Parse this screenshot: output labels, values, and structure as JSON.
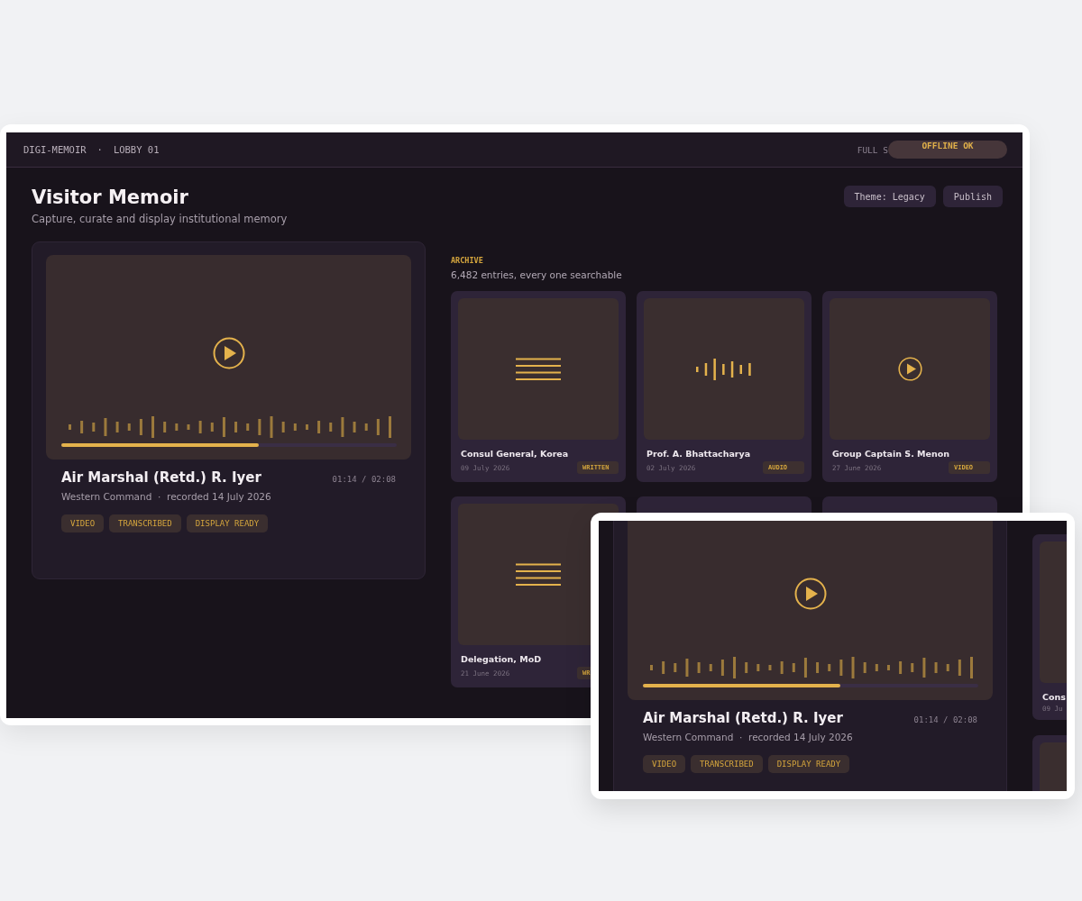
{
  "top_bar": {
    "brand": "DIGI-MEMOIR",
    "separator": "·",
    "location": "LOBBY 01",
    "mode": "FULL S",
    "status": "OFFLINE OK"
  },
  "header": {
    "title": "Visitor Memoir",
    "subtitle": "Capture, curate and display institutional memory",
    "buttons": [
      "Theme: Legacy",
      "Publish"
    ]
  },
  "featured": {
    "name": "Air Marshal (Retd.) R. Iyer",
    "time": "01:14 / 02:08",
    "subtitle": "Western Command  ·  recorded 14 July 2026",
    "level": 0.59,
    "tags": [
      "VIDEO",
      "TRANSCRIBED",
      "DISPLAY READY"
    ]
  },
  "archive": {
    "label": "ARCHIVE",
    "count": "6,482 entries, every one searchable",
    "cards": [
      {
        "kind": "written",
        "name": "Consul General, Korea",
        "date": "09 July 2026",
        "badge": "WRITTEN"
      },
      {
        "kind": "audio",
        "name": "Prof. A. Bhattacharya",
        "date": "02 July 2026",
        "badge": "AUDIO"
      },
      {
        "kind": "video",
        "name": "Group Captain S. Menon",
        "date": "27 June 2026",
        "badge": "VIDEO"
      },
      {
        "kind": "written",
        "name": "Delegation, MoD",
        "date": "21 June 2026",
        "badge": "WR"
      },
      {
        "kind": "covered"
      },
      {
        "kind": "covered"
      }
    ]
  },
  "zoom_inset": {
    "featured": {
      "name": "Air Marshal (Retd.) R. Iyer",
      "time": "01:14 / 02:08",
      "subtitle": "Western Command  ·  recorded 14 July 2026",
      "level": 0.59,
      "tags": [
        "VIDEO",
        "TRANSCRIBED",
        "DISPLAY READY"
      ]
    },
    "side_card": {
      "name": "Cons",
      "date": "09 Ju"
    }
  }
}
